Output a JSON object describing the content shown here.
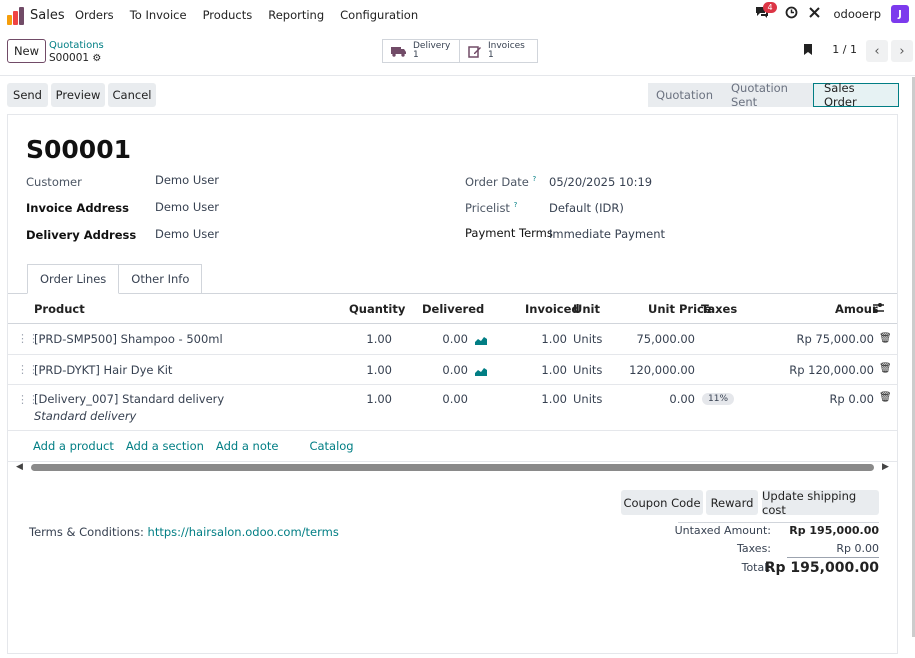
{
  "nav": {
    "app_name": "Sales",
    "menu": [
      "Orders",
      "To Invoice",
      "Products",
      "Reporting",
      "Configuration"
    ],
    "chat_count": "4",
    "db_name": "odooerp",
    "avatar_letter": "J",
    "icons": [
      "chat-icon",
      "clock-icon",
      "tools-icon"
    ]
  },
  "control": {
    "new_label": "New",
    "breadcrumb": "Quotations",
    "record_name": "S00001",
    "delivery_label": "Delivery",
    "delivery_count": "1",
    "invoices_label": "Invoices",
    "invoices_count": "1",
    "pager": "1 / 1"
  },
  "actions": {
    "send": "Send",
    "preview": "Preview",
    "cancel": "Cancel",
    "stages": [
      "Quotation",
      "Quotation Sent",
      "Sales Order"
    ],
    "active_stage": "Sales Order"
  },
  "form": {
    "title": "S00001",
    "customer_label": "Customer",
    "customer": "Demo User",
    "invoice_address_label": "Invoice Address",
    "invoice_address": "Demo User",
    "delivery_address_label": "Delivery Address",
    "delivery_address": "Demo User",
    "order_date_label": "Order Date",
    "order_date": "05/20/2025 10:19",
    "pricelist_label": "Pricelist",
    "pricelist": "Default (IDR)",
    "payment_terms_label": "Payment Terms",
    "payment_terms": "Immediate Payment",
    "help_mark": "?"
  },
  "tabs": {
    "order_lines": "Order Lines",
    "other_info": "Other Info"
  },
  "table": {
    "headers": {
      "product": "Product",
      "quantity": "Quantity",
      "delivered": "Delivered",
      "invoiced": "Invoiced",
      "unit": "Unit",
      "unit_price": "Unit Price",
      "taxes": "Taxes",
      "amount": "Amour"
    },
    "rows": [
      {
        "product": "[PRD-SMP500] Shampoo - 500ml",
        "quantity": "1.00",
        "delivered": "0.00",
        "invoiced": "1.00",
        "unit": "Units",
        "unit_price": "75,000.00",
        "taxes": "",
        "amount": "Rp 75,000.00"
      },
      {
        "product": "[PRD-DYKT] Hair Dye Kit",
        "quantity": "1.00",
        "delivered": "0.00",
        "invoiced": "1.00",
        "unit": "Units",
        "unit_price": "120,000.00",
        "taxes": "",
        "amount": "Rp 120,000.00"
      },
      {
        "product": "[Delivery_007] Standard delivery",
        "description": "Standard delivery",
        "quantity": "1.00",
        "delivered": "0.00",
        "invoiced": "1.00",
        "unit": "Units",
        "unit_price": "0.00",
        "taxes": "11%",
        "amount": "Rp 0.00"
      }
    ],
    "add_product": "Add a product",
    "add_section": "Add a section",
    "add_note": "Add a note",
    "catalog": "Catalog"
  },
  "footer": {
    "coupon_code": "Coupon Code",
    "reward": "Reward",
    "update_shipping": "Update shipping cost",
    "terms_label": "Terms & Conditions:",
    "terms_link": "https://hairsalon.odoo.com/terms",
    "untaxed_label": "Untaxed Amount:",
    "untaxed": "Rp 195,000.00",
    "taxes_label": "Taxes:",
    "taxes": "Rp 0.00",
    "total_label": "Total:",
    "total": "Rp 195,000.00"
  },
  "colors": {
    "brand": "#714b67",
    "link": "#017e84",
    "badge": "#dc3545",
    "avatar": "#7c3aed"
  }
}
